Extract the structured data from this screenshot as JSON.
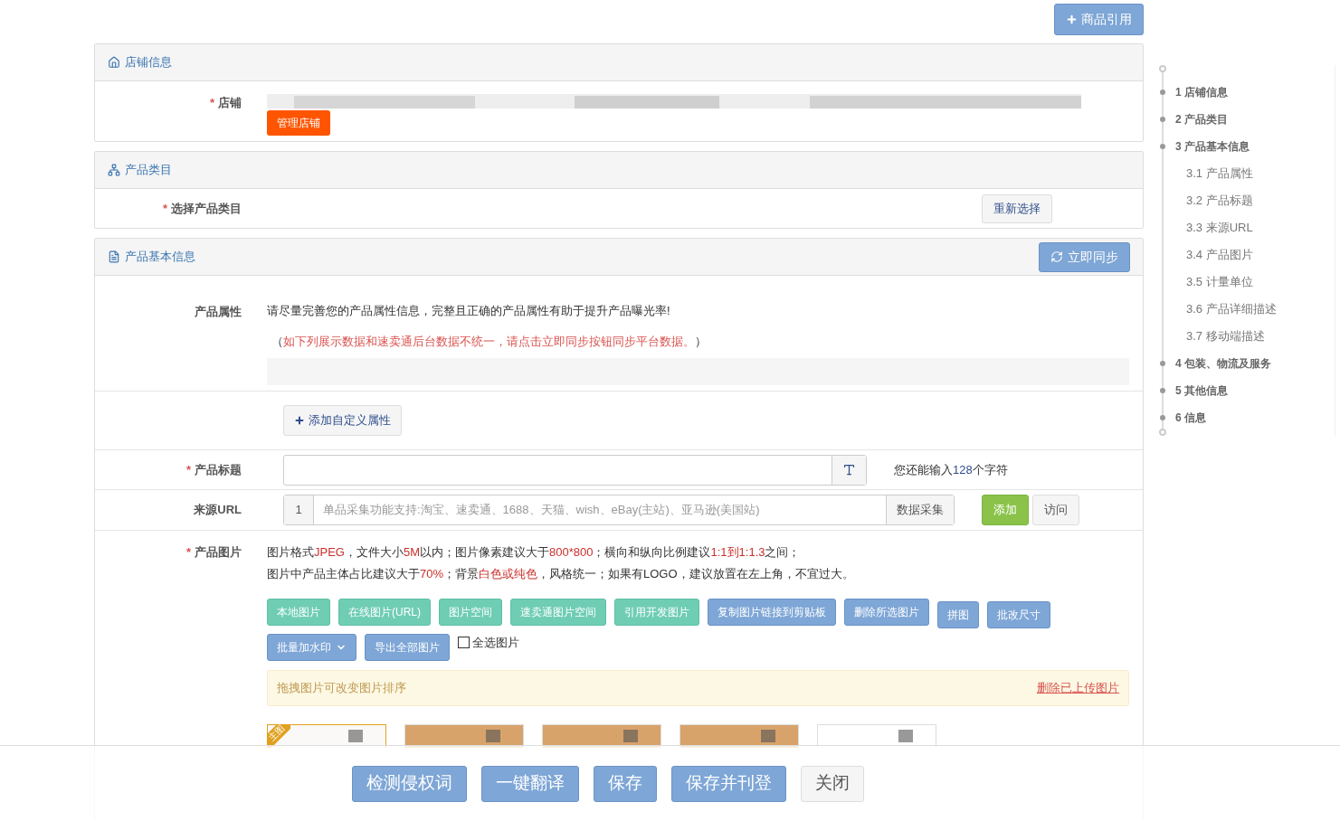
{
  "top_button": {
    "label": "商品引用"
  },
  "store_section": {
    "title": "店铺信息",
    "field_label": "店铺",
    "required_mark": "*",
    "manage_button": "管理店铺"
  },
  "category_section": {
    "title": "产品类目",
    "field_label": "选择产品类目",
    "required_mark": "*",
    "reselect_button": "重新选择"
  },
  "basic_section": {
    "title": "产品基本信息",
    "sync_button": "立即同步",
    "attributes": {
      "label": "产品属性",
      "tip": "请尽量完善您的产品属性信息，完整且正确的产品属性有助于提升产品曝光率!",
      "warning_open": "（",
      "warning": "如下列展示数据和速卖通后台数据不统一，请点击立即同步按钮同步平台数据。",
      "warning_close": "）"
    },
    "add_attribute_button": "添加自定义属性",
    "title_field": {
      "label": "产品标题",
      "required_mark": "*",
      "remaining_prefix": "您还能输入",
      "remaining_count": "128",
      "remaining_suffix": "个字符"
    },
    "source_url": {
      "label": "来源URL",
      "index": "1",
      "placeholder": "单品采集功能支持:淘宝、速卖通、1688、天猫、wish、eBay(主站)、亚马逊(美国站)",
      "collect_button": "数据采集",
      "add_button": "添加",
      "visit_button": "访问"
    },
    "images": {
      "label": "产品图片",
      "required_mark": "*",
      "rules": [
        [
          {
            "text": "图片格式",
            "highlight": false
          },
          {
            "text": "JPEG",
            "highlight": true
          },
          {
            "text": "，文件大小",
            "highlight": false
          },
          {
            "text": "5M",
            "highlight": true
          },
          {
            "text": "以内；图片像素建议大于",
            "highlight": false
          },
          {
            "text": "800*800",
            "highlight": true
          },
          {
            "text": "；横向和纵向比例建议",
            "highlight": false
          },
          {
            "text": "1:1到1:1.3",
            "highlight": true
          },
          {
            "text": "之间；",
            "highlight": false
          }
        ],
        [
          {
            "text": "图片中产品主体占比建议大于",
            "highlight": false
          },
          {
            "text": "70%",
            "highlight": true
          },
          {
            "text": "；背景",
            "highlight": false
          },
          {
            "text": "白色或纯色",
            "highlight": true
          },
          {
            "text": "，风格统一；如果有LOGO，建议放置在左上角，不宜过大。",
            "highlight": false
          }
        ]
      ],
      "tools": [
        {
          "label": "本地图片",
          "kind": "teal"
        },
        {
          "label": "在线图片(URL)",
          "kind": "teal"
        },
        {
          "label": "图片空间",
          "kind": "teal"
        },
        {
          "label": "速卖通图片空间",
          "kind": "teal"
        },
        {
          "label": "引用开发图片",
          "kind": "teal"
        },
        {
          "label": "复制图片链接到剪贴板",
          "kind": "blue"
        },
        {
          "label": "删除所选图片",
          "kind": "blue"
        },
        {
          "label": "拼图",
          "kind": "blue"
        },
        {
          "label": "批改尺寸",
          "kind": "blue"
        },
        {
          "label": "批量加水印",
          "kind": "dropdown"
        },
        {
          "label": "导出全部图片",
          "kind": "blue"
        }
      ],
      "select_all": {
        "label": "全选图片",
        "checked": false
      },
      "drag_hint": "拖拽图片可改变图片排序",
      "delete_uploaded": "删除已上传图片",
      "thumbnails": [
        {
          "kind": "main",
          "badge": "主图"
        },
        {
          "kind": "picture"
        },
        {
          "kind": "picture"
        },
        {
          "kind": "picture"
        },
        {
          "kind": "picture"
        }
      ]
    }
  },
  "nav": [
    {
      "label": "1 店铺信息"
    },
    {
      "label": "2 产品类目"
    },
    {
      "label": "3 产品基本信息",
      "children": [
        {
          "label": "3.1 产品属性"
        },
        {
          "label": "3.2 产品标题"
        },
        {
          "label": "3.3 来源URL"
        },
        {
          "label": "3.4 产品图片"
        },
        {
          "label": "3.5 计量单位"
        },
        {
          "label": "3.6 产品详细描述"
        },
        {
          "label": "3.7 移动端描述"
        }
      ]
    },
    {
      "label": "4 包装、物流及服务"
    },
    {
      "label": "5 其他信息"
    },
    {
      "label": "6 信息"
    }
  ],
  "bottom_bar": [
    {
      "label": "检测侵权词",
      "kind": "primary"
    },
    {
      "label": "一键翻译",
      "kind": "primary"
    },
    {
      "label": "保存",
      "kind": "primary"
    },
    {
      "label": "保存并刊登",
      "kind": "primary"
    },
    {
      "label": "关闭",
      "kind": "default"
    }
  ]
}
